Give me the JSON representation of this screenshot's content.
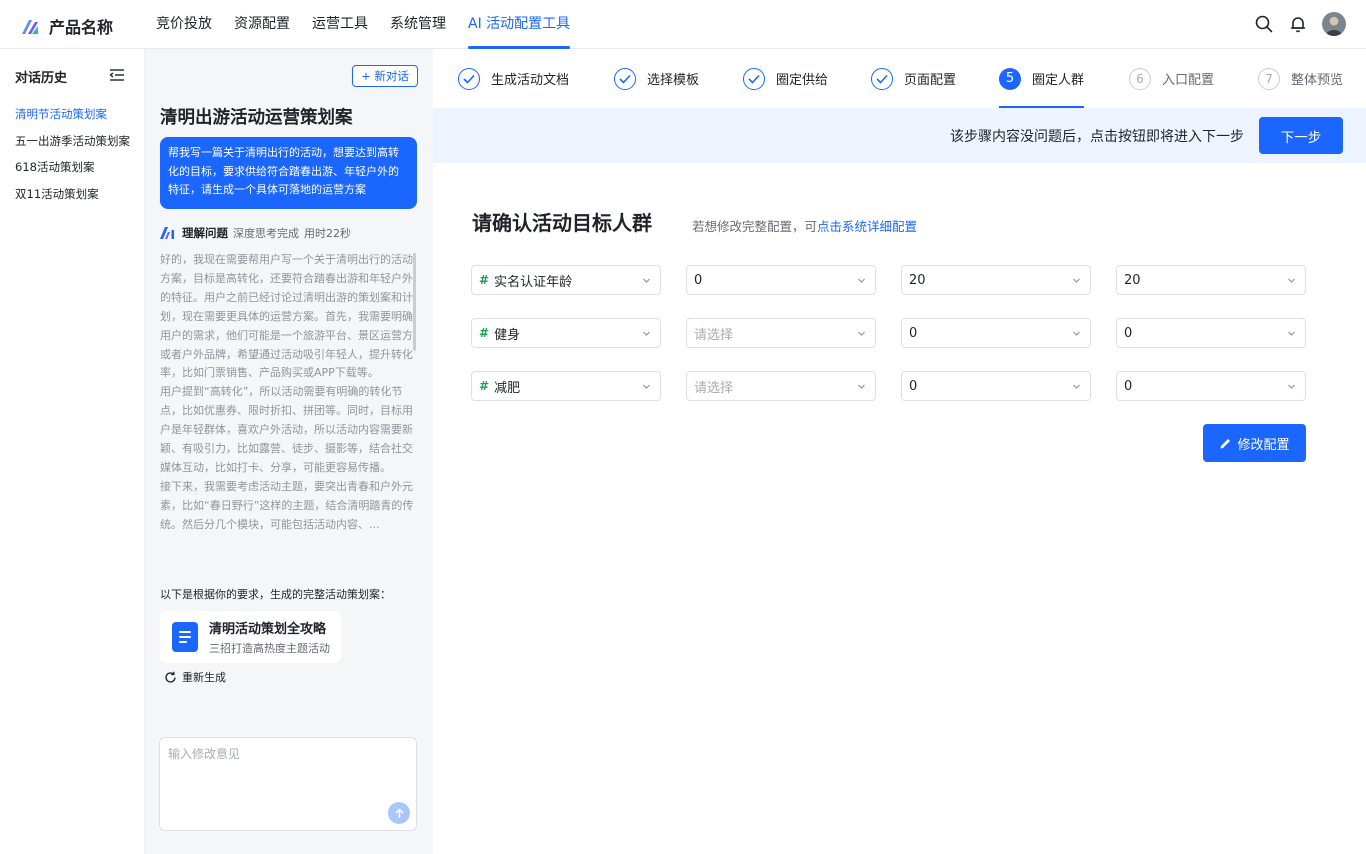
{
  "app": {
    "name": "产品名称"
  },
  "nav": {
    "items": [
      "竞价投放",
      "资源配置",
      "运营工具",
      "系统管理",
      "AI 活动配置工具"
    ],
    "active_index": 4
  },
  "history": {
    "title": "对话历史",
    "items": [
      "清明节活动策划案",
      "五一出游季活动策划案",
      "618活动策划案",
      "双11活动策划案"
    ],
    "active_index": 0
  },
  "chat": {
    "new_chat_label": "+ 新对话",
    "title": "清明出游活动运营策划案",
    "user_message": "帮我写一篇关于清明出行的活动，想要达到高转化的目标，要求供给符合踏春出游、年轻户外的特征，请生成一个具体可落地的运营方案",
    "thinking": {
      "label": "理解问题",
      "status": "深度思考完成",
      "duration": "用时22秒",
      "paragraphs": [
        "好的，我现在需要帮用户写一个关于清明出行的活动方案，目标是高转化，还要符合踏春出游和年轻户外的特征。用户之前已经讨论过清明出游的策划案和计划，现在需要更具体的运营方案。首先，我需要明确用户的需求，他们可能是一个旅游平台、景区运营方或者户外品牌，希望通过活动吸引年轻人，提升转化率，比如门票销售、产品购买或APP下载等。",
        "用户提到“高转化”，所以活动需要有明确的转化节点，比如优惠券、限时折扣、拼团等。同时，目标用户是年轻群体，喜欢户外活动，所以活动内容需要新颖、有吸引力，比如露营、徒步、摄影等，结合社交媒体互动，比如打卡、分享，可能更容易传播。",
        "接下来，我需要考虑活动主题，要突出青春和户外元素，比如“春日野行”这样的主题，结合清明踏青的传统。然后分几个模块，可能包括活动内容、..."
      ]
    },
    "result_intro": "以下是根据你的要求，生成的完整活动策划案：",
    "doc": {
      "title": "清明活动策划全攻略",
      "subtitle": "三招打造高热度主题活动"
    },
    "regenerate_label": "重新生成",
    "input_placeholder": "输入修改意见"
  },
  "steps": [
    {
      "label": "生成活动文档",
      "state": "done",
      "num": ""
    },
    {
      "label": "选择模板",
      "state": "done",
      "num": ""
    },
    {
      "label": "圈定供给",
      "state": "done",
      "num": ""
    },
    {
      "label": "页面配置",
      "state": "done",
      "num": ""
    },
    {
      "label": "圈定人群",
      "state": "current",
      "num": "5"
    },
    {
      "label": "入口配置",
      "state": "todo",
      "num": "6"
    },
    {
      "label": "整体预览",
      "state": "todo",
      "num": "7"
    }
  ],
  "notice": {
    "text": "该步骤内容没问题后，点击按钮即将进入下一步",
    "next_label": "下一步"
  },
  "section": {
    "title": "请确认活动目标人群",
    "hint_prefix": "若想修改完整配置，可",
    "hint_link": "点击系统详细配置"
  },
  "rows": [
    {
      "tag": "实名认证年龄",
      "op": "0",
      "from": "20",
      "to": "20"
    },
    {
      "tag": "健身",
      "op": "请选择",
      "from": "0",
      "to": "0"
    },
    {
      "tag": "减肥",
      "op": "请选择",
      "from": "0",
      "to": "0"
    }
  ],
  "modify_label": "修改配置",
  "colors": {
    "primary": "#1a66ff",
    "tag_hash": "#18a058",
    "notice_bg": "#eef4ff",
    "chat_bg": "#f5f6f8"
  }
}
